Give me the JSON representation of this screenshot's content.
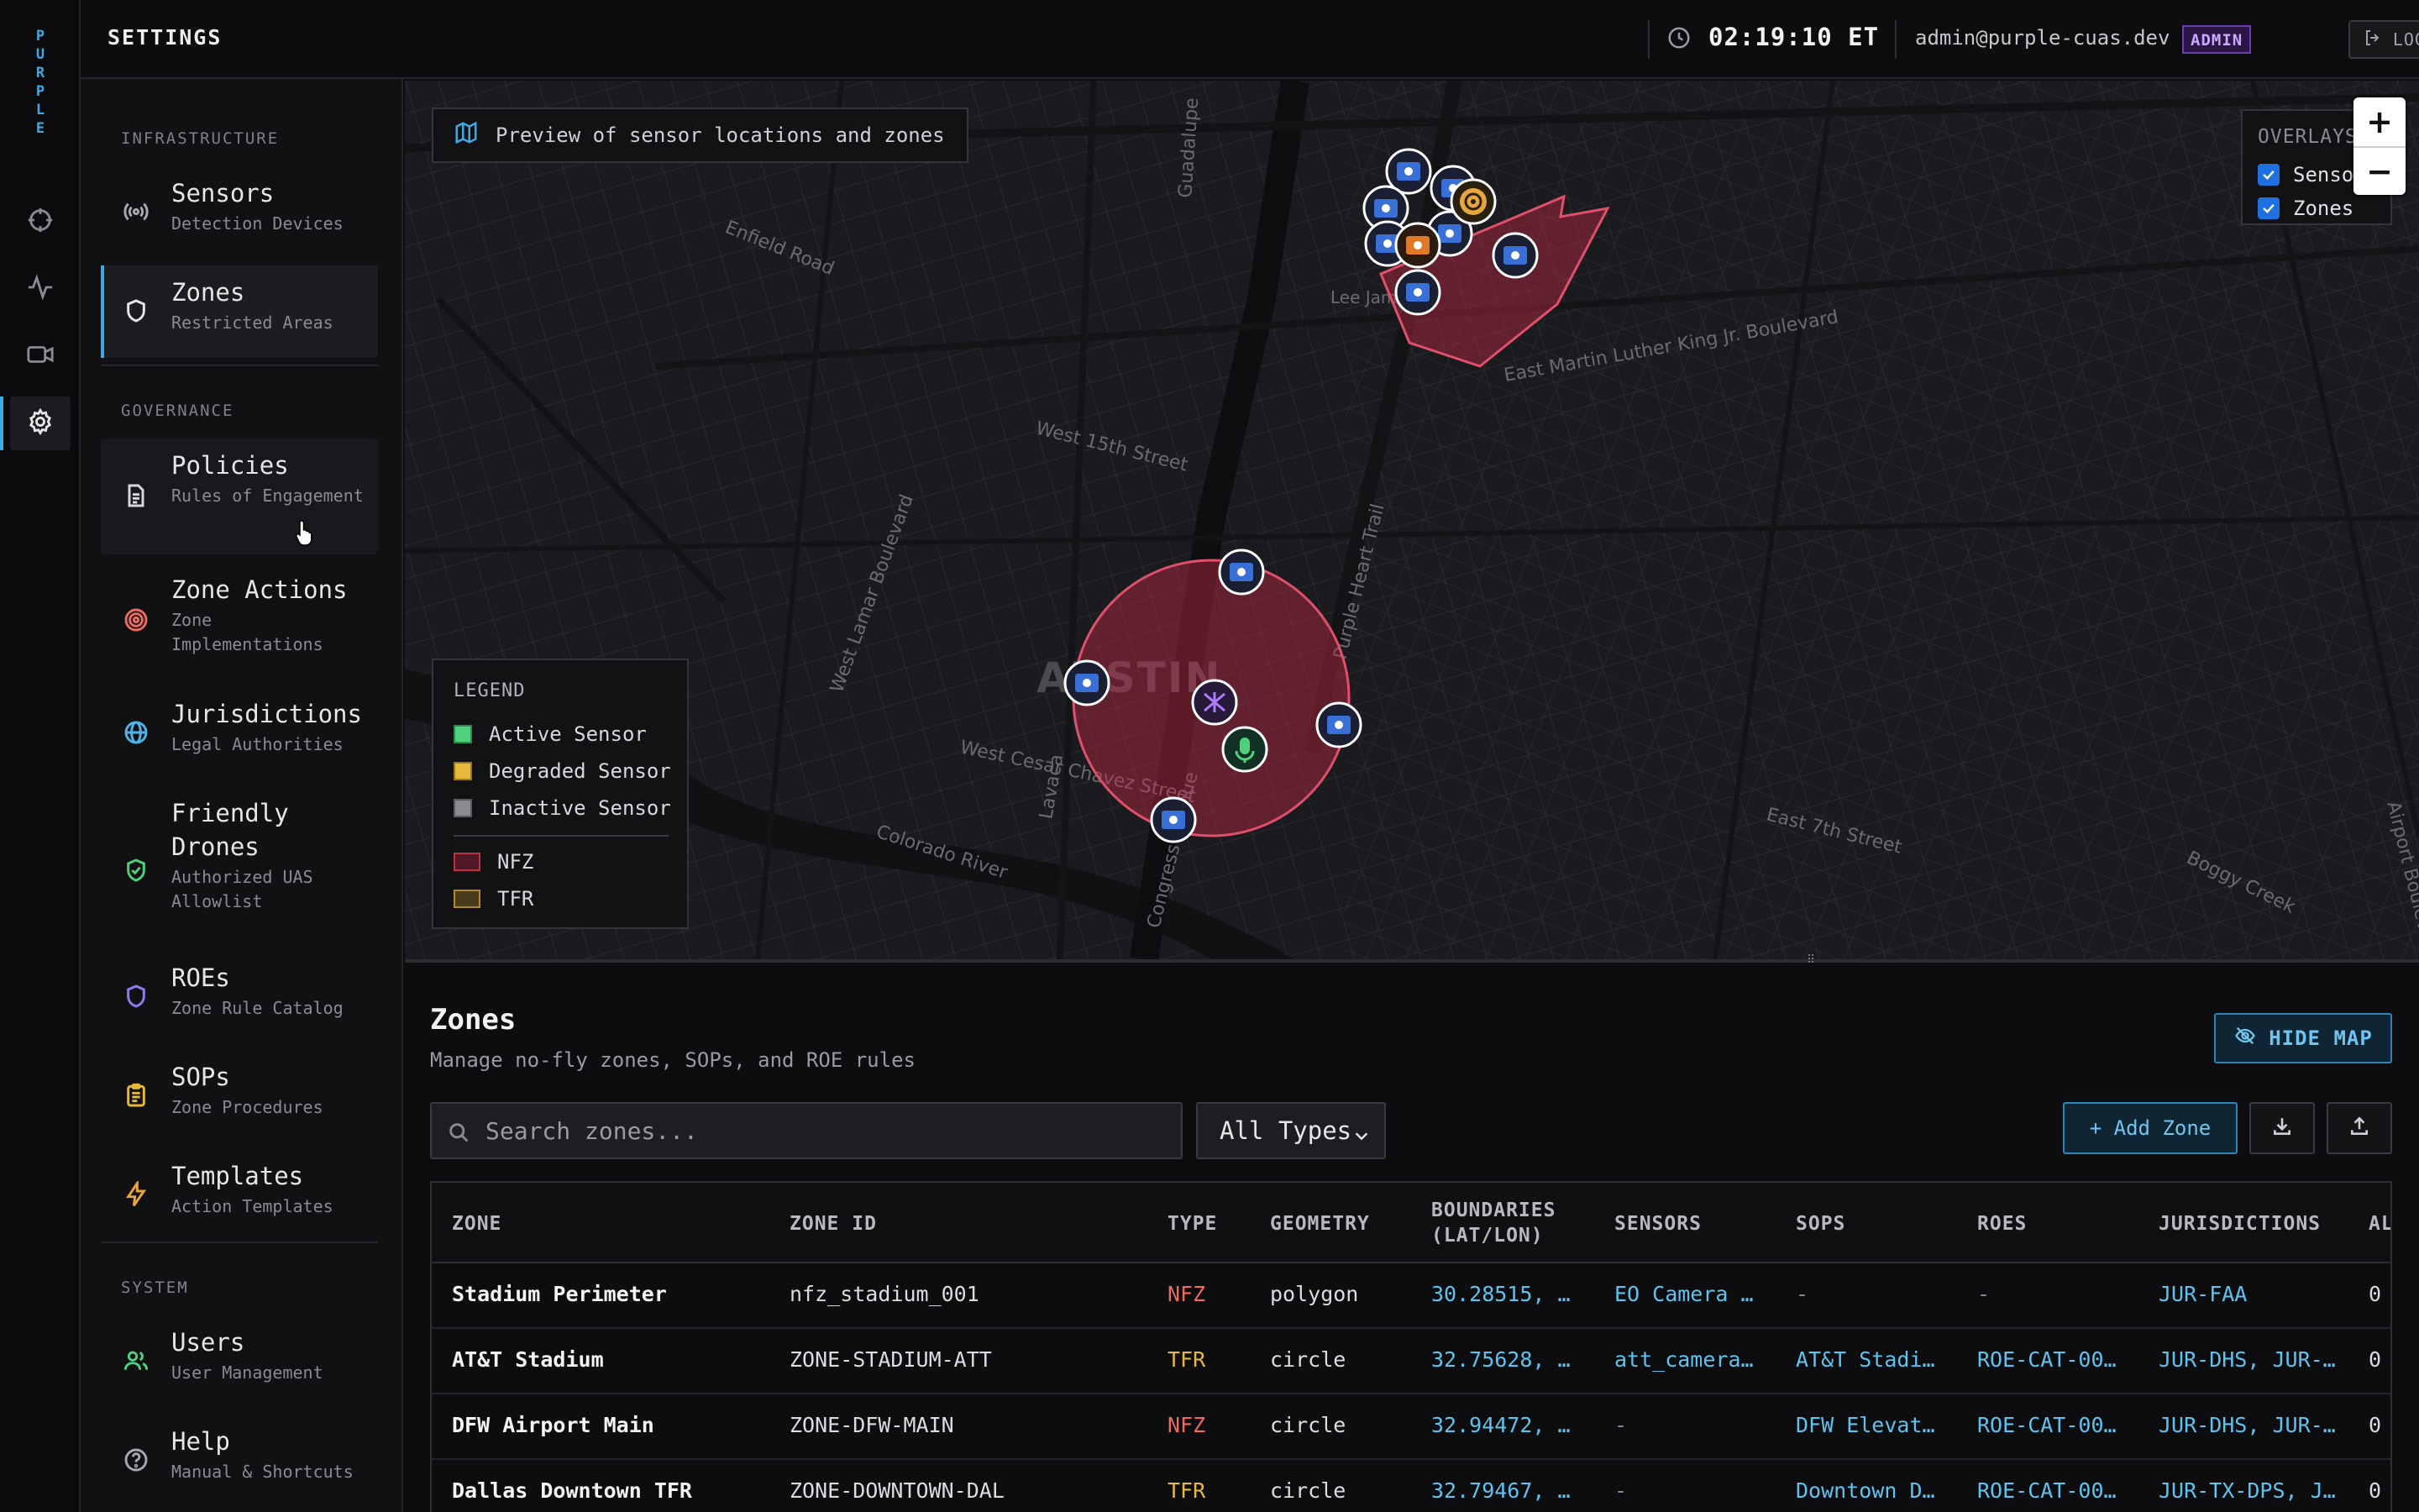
{
  "brand": "PURPLE",
  "header": {
    "title": "SETTINGS",
    "clock": "02:19:10 ET",
    "user_email": "admin@purple-cuas.dev",
    "role": "ADMIN",
    "logout_label": "LOGOUT"
  },
  "sidebar": {
    "sections": [
      {
        "heading": "INFRASTRUCTURE",
        "items": [
          {
            "title": "Sensors",
            "subtitle": "Detection Devices",
            "icon": "radio-waves-icon",
            "color": "#a8a8b0"
          },
          {
            "title": "Zones",
            "subtitle": "Restricted Areas",
            "icon": "shield-icon",
            "color": "#e6e6e6",
            "active": true
          }
        ]
      },
      {
        "heading": "GOVERNANCE",
        "items": [
          {
            "title": "Policies",
            "subtitle": "Rules of Engagement",
            "icon": "document-icon",
            "color": "#d8d8dc",
            "hover": true
          },
          {
            "title": "Zone Actions",
            "subtitle": "Zone Implementations",
            "icon": "target-icon",
            "color": "#ef6b62"
          },
          {
            "title": "Jurisdictions",
            "subtitle": "Legal Authorities",
            "icon": "globe-icon",
            "color": "#4fb3e8"
          },
          {
            "title": "Friendly Drones",
            "subtitle": "Authorized UAS Allowlist",
            "icon": "shield-check-icon",
            "color": "#4fd07a"
          },
          {
            "title": "ROEs",
            "subtitle": "Zone Rule Catalog",
            "icon": "shield-icon",
            "color": "#8b7ef2"
          },
          {
            "title": "SOPs",
            "subtitle": "Zone Procedures",
            "icon": "clipboard-icon",
            "color": "#e6b93d"
          },
          {
            "title": "Templates",
            "subtitle": "Action Templates",
            "icon": "lightning-icon",
            "color": "#e6a53d"
          }
        ]
      },
      {
        "heading": "SYSTEM",
        "items": [
          {
            "title": "Users",
            "subtitle": "User Management",
            "icon": "users-icon",
            "color": "#4fd07a"
          },
          {
            "title": "Help",
            "subtitle": "Manual & Shortcuts",
            "icon": "help-icon",
            "color": "#a8a8b0"
          }
        ]
      }
    ]
  },
  "map": {
    "caption": "Preview of sensor locations and zones",
    "city_label": "AUSTIN",
    "street_labels": [
      "West 15th Street",
      "East Martin Luther King Jr. Boulevard",
      "Purple Heart Trail",
      "West Cesar Chavez Street",
      "Colorado River",
      "East 7th Street",
      "Boggy Creek",
      "Congress Avenue",
      "Guadalupe",
      "Enfield Road",
      "West Lamar Boulevard",
      "Airport Boulevard",
      "Lavaca",
      "Lee Jam Sw"
    ],
    "legend": {
      "title": "LEGEND",
      "sensors": [
        {
          "label": "Active Sensor",
          "color": "#4fd07a"
        },
        {
          "label": "Degraded Sensor",
          "color": "#e6b93d"
        },
        {
          "label": "Inactive Sensor",
          "color": "#8a8a90"
        }
      ],
      "zones": [
        {
          "label": "NFZ",
          "color": "#c0303f"
        },
        {
          "label": "TFR",
          "color": "#b08a2a"
        }
      ]
    },
    "overlays": {
      "title": "OVERLAYS",
      "items": [
        {
          "label": "Sensors",
          "checked": true
        },
        {
          "label": "Zones",
          "checked": true
        }
      ]
    },
    "zoom_in": "+",
    "zoom_out": "−"
  },
  "zones_panel": {
    "title": "Zones",
    "subtitle": "Manage no-fly zones, SOPs, and ROE rules",
    "hide_map_label": "HIDE MAP",
    "search_placeholder": "Search zones...",
    "type_filter": "All Types",
    "add_zone_label": "+ Add Zone",
    "columns": [
      "ZONE",
      "ZONE ID",
      "TYPE",
      "GEOMETRY",
      "BOUNDARIES (LAT/LON)",
      "SENSORS",
      "SOPS",
      "ROES",
      "JURISDICTIONS",
      "AL"
    ],
    "rows": [
      {
        "zone": "Stadium Perimeter",
        "zone_id": "nfz_stadium_001",
        "type": "NFZ",
        "geometry": "polygon",
        "boundaries": "30.28515, …",
        "sensors": "EO Camera …",
        "sops": "-",
        "roes": "-",
        "jurisdictions": "JUR-FAA",
        "al": "0"
      },
      {
        "zone": "AT&T Stadium",
        "zone_id": "ZONE-STADIUM-ATT",
        "type": "TFR",
        "geometry": "circle",
        "boundaries": "32.75628, …",
        "sensors": "att_camera…",
        "sops": "AT&T Stadi…",
        "roes": "ROE-CAT-00…",
        "jurisdictions": "JUR-DHS, JUR-…",
        "al": "0"
      },
      {
        "zone": "DFW Airport Main",
        "zone_id": "ZONE-DFW-MAIN",
        "type": "NFZ",
        "geometry": "circle",
        "boundaries": "32.94472, …",
        "sensors": "-",
        "sops": "DFW Elevat…",
        "roes": "ROE-CAT-00…",
        "jurisdictions": "JUR-DHS, JUR-…",
        "al": "0"
      },
      {
        "zone": "Dallas Downtown TFR",
        "zone_id": "ZONE-DOWNTOWN-DAL",
        "type": "TFR",
        "geometry": "circle",
        "boundaries": "32.79467, …",
        "sensors": "-",
        "sops": "Downtown D…",
        "roes": "ROE-CAT-00…",
        "jurisdictions": "JUR-TX-DPS, J…",
        "al": "0"
      }
    ]
  }
}
